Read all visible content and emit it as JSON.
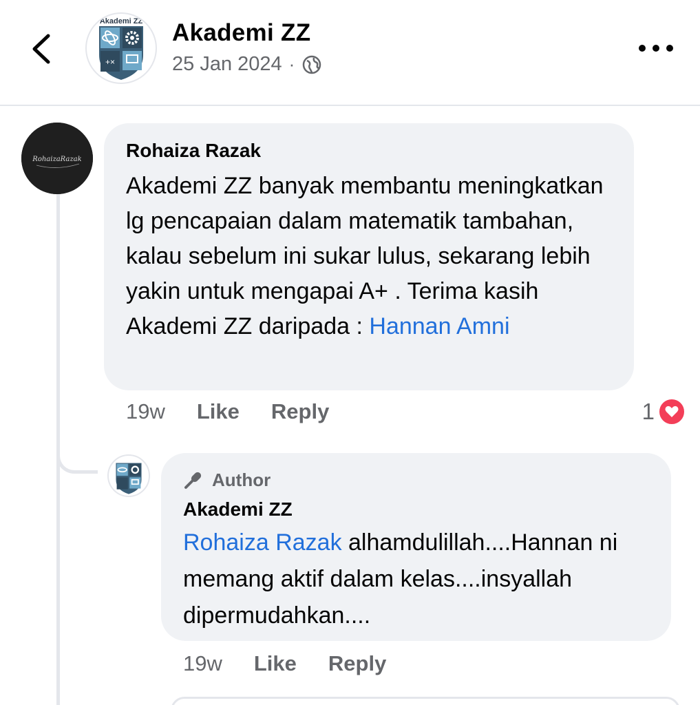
{
  "header": {
    "back_icon": "chevron-left-icon",
    "page_name": "Akademi ZZ",
    "date": "25 Jan 2024",
    "separator": "·",
    "privacy_icon": "globe-icon",
    "more_icon": "more-horizontal-icon",
    "logo_text": "Akademi ZZ"
  },
  "comment": {
    "author": "Rohaiza Razak",
    "avatar_text": "RohaizaRazak",
    "text": "Akademi ZZ banyak membantu meningkatkan lg pencapaian dalam matematik tambahan, kalau sebelum ini sukar lulus, sekarang lebih yakin untuk mengapai A+ . Terima kasih Akademi ZZ daripada :",
    "mention": "Hannan Amni",
    "time": "19w",
    "like_label": "Like",
    "reply_label": "Reply",
    "reaction_count": "1",
    "reaction_icon": "heart-icon"
  },
  "reply": {
    "badge_icon": "microphone-icon",
    "badge_label": "Author",
    "author": "Akademi ZZ",
    "mention": "Rohaiza Razak",
    "text": "alhamdulillah....Hannan ni memang aktif dalam kelas....insyallah dipermudahkan....",
    "time": "19w",
    "like_label": "Like",
    "reply_label": "Reply"
  },
  "colors": {
    "link": "#216fdb",
    "bubble": "#f0f2f5",
    "secondary_text": "#65676b",
    "heart": "#f33e58"
  }
}
